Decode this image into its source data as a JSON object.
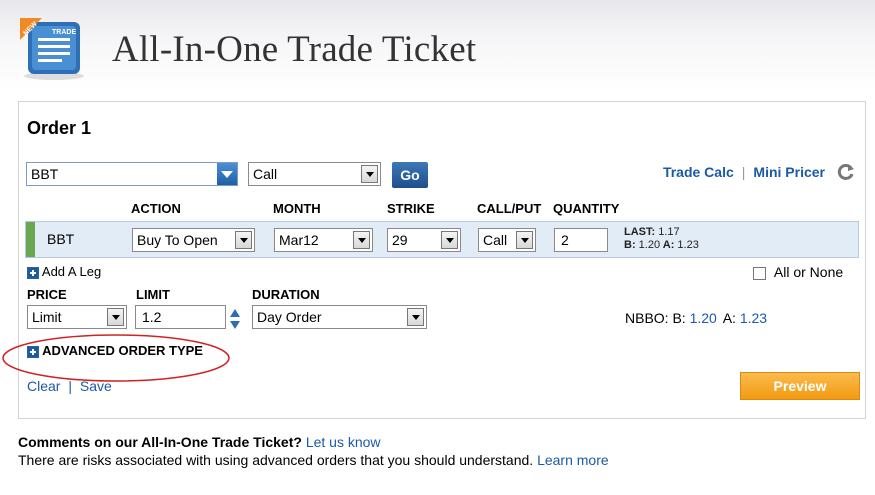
{
  "header": {
    "logo_badge": "NEW",
    "logo_text": "TRADE",
    "title": "All-In-One Trade Ticket"
  },
  "order": {
    "title": "Order 1",
    "symbol_value": "BBT",
    "option_type_value": "Call",
    "go_label": "Go",
    "links": {
      "trade_calc": "Trade Calc",
      "separator": "|",
      "mini_pricer": "Mini Pricer"
    },
    "columns": {
      "action": "ACTION",
      "month": "MONTH",
      "strike": "STRIKE",
      "call_put": "CALL/PUT",
      "quantity": "QUANTITY"
    },
    "leg": {
      "symbol": "BBT",
      "action": "Buy To Open",
      "month": "Mar12",
      "strike": "29",
      "call_put": "Call",
      "quantity": "2",
      "last_label": "LAST:",
      "last_value": "1.17",
      "bid_label": "B:",
      "bid_value": "1.20",
      "ask_label": "A:",
      "ask_value": "1.23"
    },
    "add_leg_label": "Add A Leg",
    "all_or_none_label": "All or None",
    "price_label": "PRICE",
    "price_value": "Limit",
    "limit_label": "LIMIT",
    "limit_value": "1.2",
    "duration_label": "DURATION",
    "duration_value": "Day Order",
    "nbbo_label": "NBBO: B:",
    "nbbo_bid": "1.20",
    "nbbo_ask_label": "A:",
    "nbbo_ask": "1.23",
    "advanced_label": "ADVANCED ORDER TYPE",
    "clear_label": "Clear",
    "action_sep": "|",
    "save_label": "Save",
    "preview_label": "Preview"
  },
  "footer": {
    "comments_text": "Comments on our All-In-One Trade Ticket?",
    "let_us_know": "Let us know",
    "risk_text": "There are risks associated with using advanced orders that you should understand.",
    "learn_more": "Learn more"
  },
  "colors": {
    "link": "#1a5aa6",
    "accent_blue": "#1f5fa8",
    "preview_orange": "#f39a10",
    "leg_green": "#6aa84f",
    "leg_row_bg": "#e2ecf6",
    "annotation_red": "#d42020"
  },
  "icons": [
    "trade-ticket-logo-icon",
    "refresh-icon",
    "plus-icon",
    "spinner-icon",
    "dropdown-arrow-icon"
  ]
}
